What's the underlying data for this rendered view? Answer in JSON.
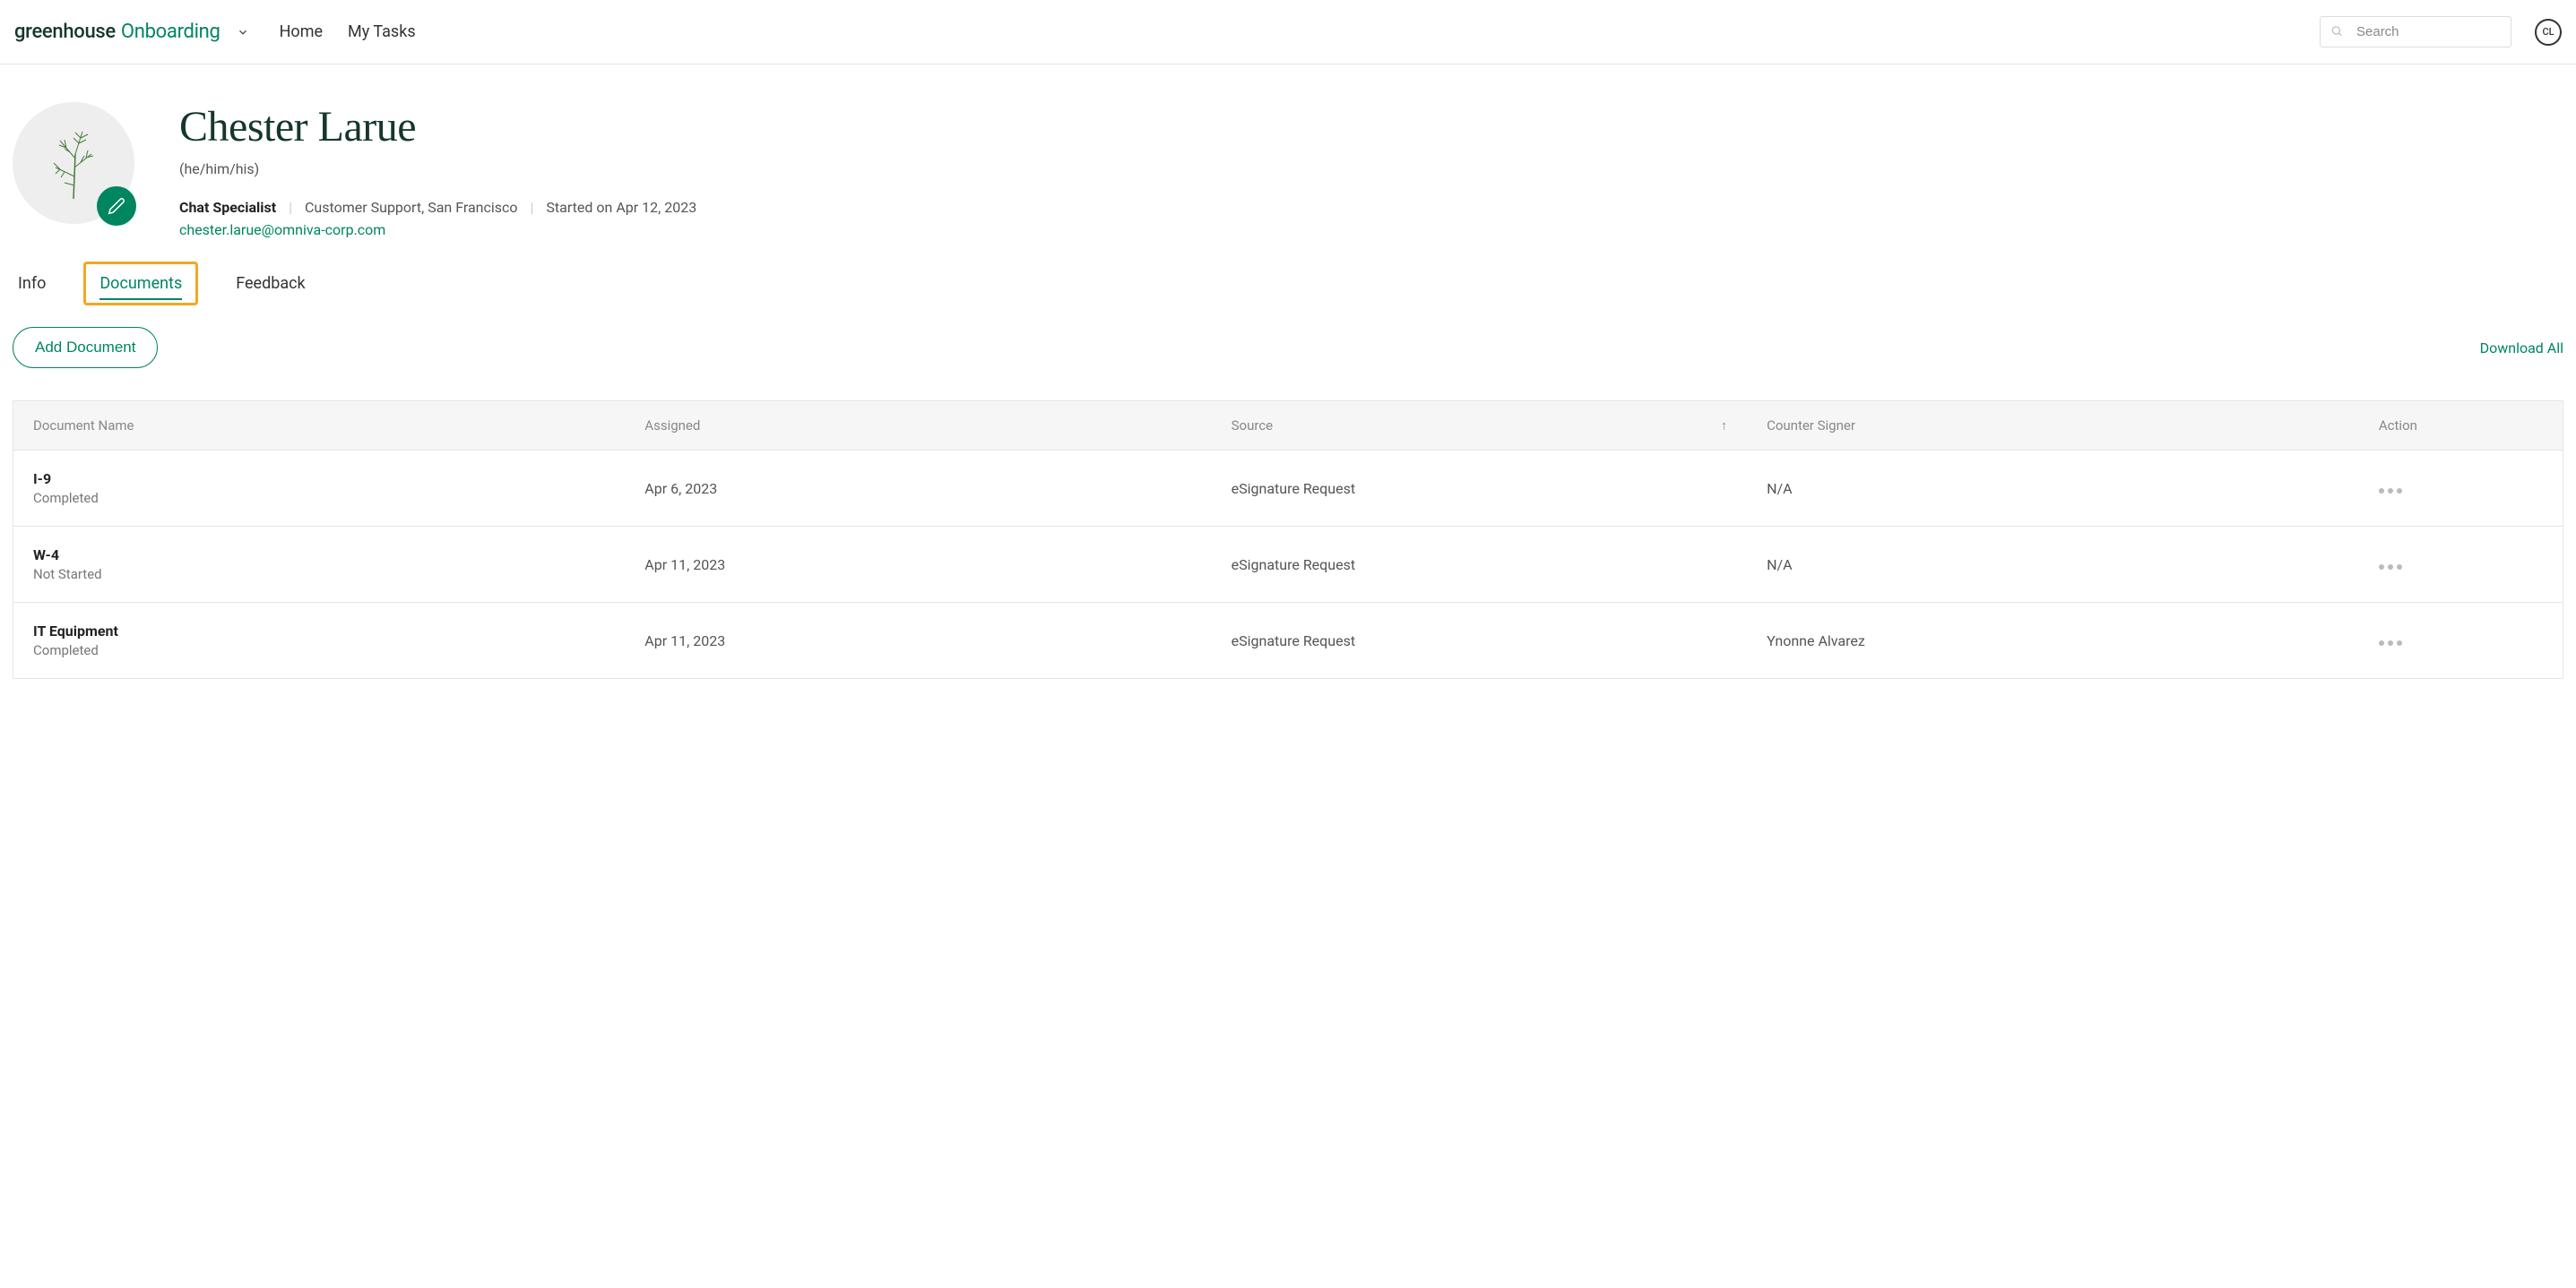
{
  "header": {
    "logo_greenhouse": "greenhouse",
    "logo_onboarding": "Onboarding",
    "nav": {
      "home": "Home",
      "my_tasks": "My Tasks"
    },
    "search_placeholder": "Search",
    "initials": "CL"
  },
  "profile": {
    "name": "Chester Larue",
    "pronouns": "(he/him/his)",
    "role": "Chat Specialist",
    "department": "Customer Support, San Francisco",
    "started": "Started on Apr 12, 2023",
    "email": "chester.larue@omniva-corp.com"
  },
  "tabs": {
    "info": "Info",
    "documents": "Documents",
    "feedback": "Feedback"
  },
  "actions": {
    "add_document": "Add Document",
    "download_all": "Download All"
  },
  "table": {
    "headers": {
      "name": "Document Name",
      "assigned": "Assigned",
      "source": "Source",
      "counter": "Counter Signer",
      "action": "Action"
    },
    "rows": [
      {
        "name": "I-9",
        "status": "Completed",
        "assigned": "Apr 6, 2023",
        "source": "eSignature Request",
        "counter": "N/A"
      },
      {
        "name": "W-4",
        "status": "Not Started",
        "assigned": "Apr 11, 2023",
        "source": "eSignature Request",
        "counter": "N/A"
      },
      {
        "name": "IT Equipment",
        "status": "Completed",
        "assigned": "Apr 11, 2023",
        "source": "eSignature Request",
        "counter": "Ynonne Alvarez"
      }
    ]
  }
}
